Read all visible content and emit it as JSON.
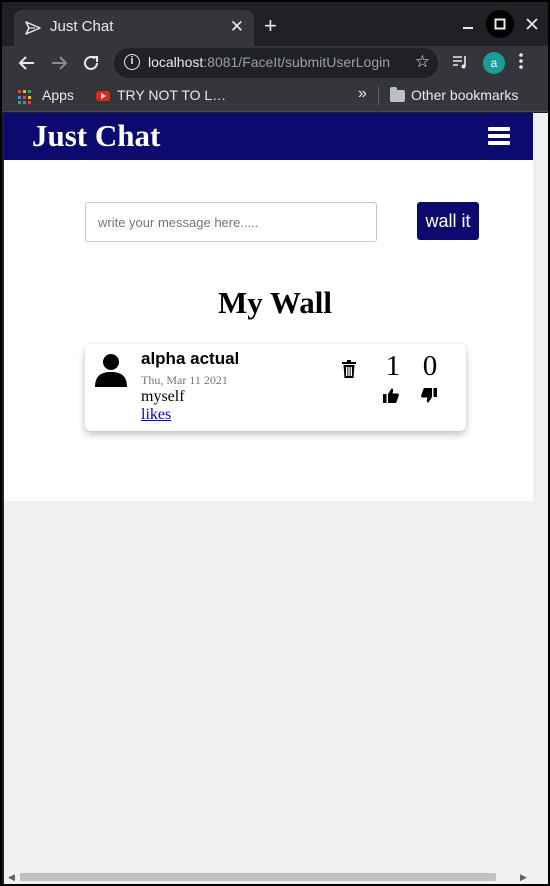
{
  "browser": {
    "tab_title": "Just Chat",
    "tab_close": "✕",
    "new_tab": "+",
    "url_host": "localhost",
    "url_path": ":8081/FaceIt/submitUserLogin",
    "avatar_letter": "a",
    "bookmarks": {
      "apps_label": "Apps",
      "video_label": "TRY NOT TO L…",
      "overflow": "»",
      "other_label": "Other bookmarks"
    },
    "icons": {
      "favicon": "send-arrow-icon",
      "back": "arrow-left-icon",
      "forward": "arrow-right-icon",
      "reload": "reload-icon",
      "info": "info-icon",
      "star": "star-icon",
      "media": "media-queue-icon",
      "menu": "kebab-menu-icon"
    }
  },
  "app": {
    "brand": "Just Chat",
    "nav_menu_icon": "hamburger-icon",
    "colors": {
      "primary": "#0c0a6e",
      "link": "#0000ee",
      "muted": "#777777"
    },
    "composer": {
      "placeholder": "write your message here.....",
      "value": "",
      "submit_label": "wall it"
    },
    "wall_title": "My Wall",
    "posts": [
      {
        "author": "alpha actual",
        "date": "Thu, Mar 11 2021",
        "text": "myself",
        "likes_link": "likes",
        "like_count": "1",
        "dislike_count": "0",
        "icons": {
          "avatar": "user-silhouette-icon",
          "delete": "trash-icon",
          "like": "thumbs-up-icon",
          "dislike": "thumbs-down-icon"
        }
      }
    ]
  }
}
